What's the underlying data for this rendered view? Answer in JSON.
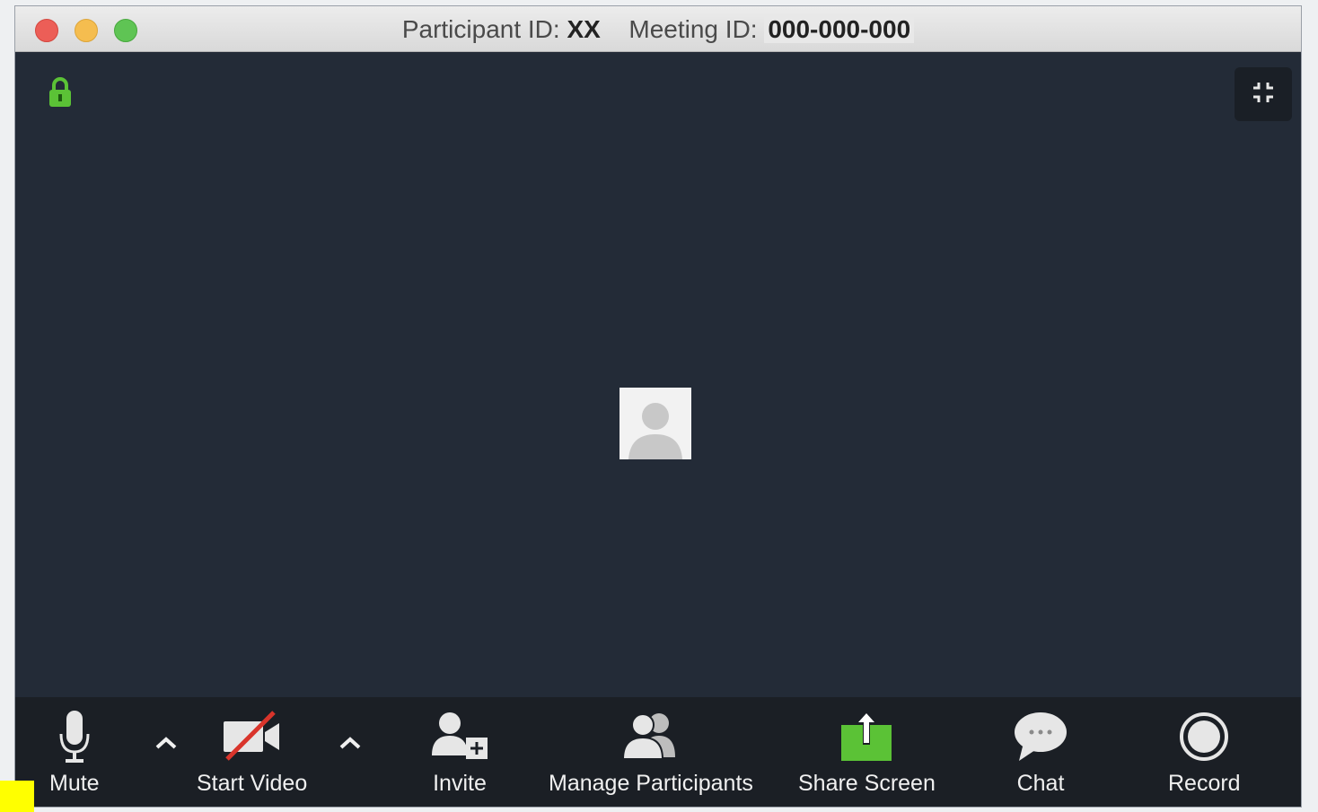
{
  "window": {
    "title_participant_label": "Participant ID:",
    "title_participant_value": "XX",
    "title_meeting_label": "Meeting ID:",
    "title_meeting_value": "000-000-000"
  },
  "toolbar": {
    "mute_label": "Mute",
    "start_video_label": "Start Video",
    "invite_label": "Invite",
    "manage_participants_label": "Manage Participants",
    "share_screen_label": "Share Screen",
    "chat_label": "Chat",
    "record_label": "Record"
  },
  "colors": {
    "background": "#232b37",
    "toolbar": "#1b1f25",
    "accent_green": "#5bc236",
    "video_off_red": "#d9342b"
  },
  "icons": [
    "lock-icon",
    "fullscreen-icon",
    "avatar-placeholder",
    "microphone-icon",
    "video-off-icon",
    "invite-icon",
    "participants-icon",
    "share-screen-icon",
    "chat-icon",
    "record-icon",
    "chevron-up-icon"
  ]
}
